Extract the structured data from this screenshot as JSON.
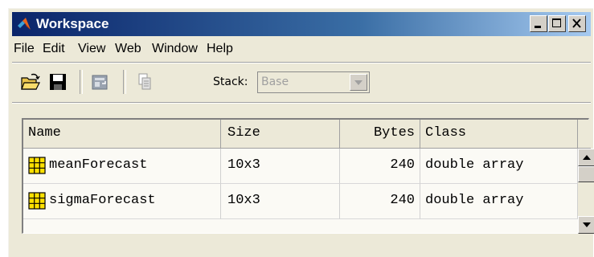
{
  "window": {
    "title": "Workspace",
    "title_icon": "matlab-logo-icon"
  },
  "title_buttons": [
    {
      "name": "minimize",
      "icon": "minimize-icon"
    },
    {
      "name": "maximize",
      "icon": "maximize-icon"
    },
    {
      "name": "close",
      "icon": "close-icon"
    }
  ],
  "menu": [
    {
      "label": "File"
    },
    {
      "label": "Edit"
    },
    {
      "label": "View"
    },
    {
      "label": "Web"
    },
    {
      "label": "Window"
    },
    {
      "label": "Help"
    }
  ],
  "toolbar": {
    "open_icon": "open-folder-icon",
    "save_icon": "save-icon",
    "import_icon": "import-data-icon",
    "delete_icon": "delete-icon",
    "stack_label": "Stack:",
    "stack_value": "Base"
  },
  "table": {
    "columns": [
      "Name",
      "Size",
      "Bytes",
      "Class"
    ],
    "rows": [
      {
        "name": "meanForecast",
        "size": "10x3",
        "bytes": "240",
        "class": "double array"
      },
      {
        "name": "sigmaForecast",
        "size": "10x3",
        "bytes": "240",
        "class": "double array"
      }
    ]
  },
  "colors": {
    "title_start": "#0a246a",
    "title_end": "#a6caf0",
    "chrome": "#ece9d8",
    "array_icon": "#ffe000"
  }
}
